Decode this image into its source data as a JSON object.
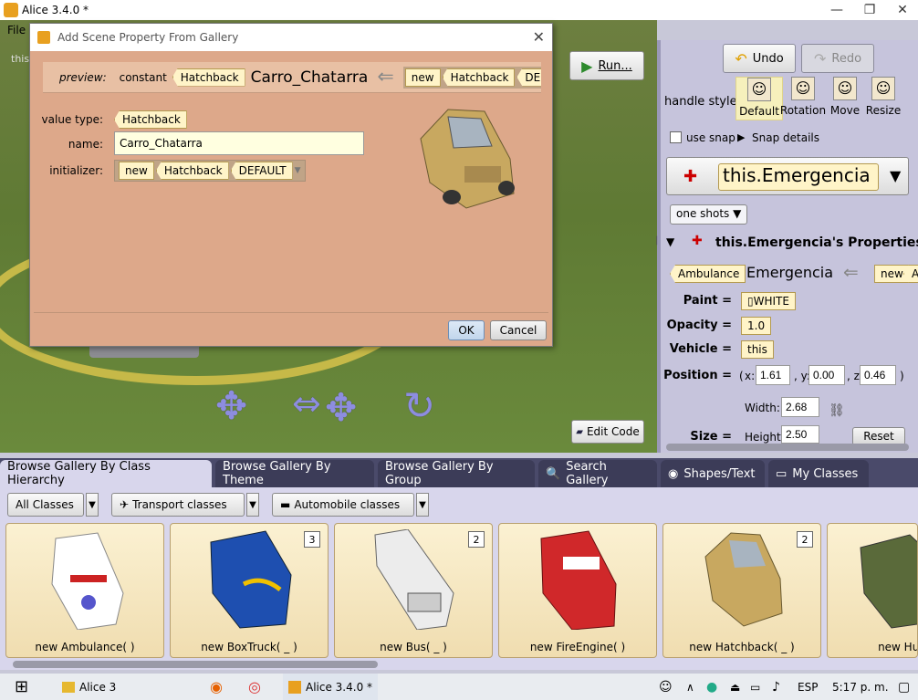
{
  "window": {
    "title": "Alice 3.4.0  *",
    "min": "—",
    "restore": "❐",
    "close": "✕"
  },
  "menu": {
    "file": "File",
    "scene_label": "this"
  },
  "run_button": "Run...",
  "edit_code_button": "Edit Code",
  "dialog": {
    "title": "Add Scene Property From Gallery",
    "close": "✕",
    "preview_label": "preview:",
    "preview_constant": "constant",
    "preview_type": "Hatchback",
    "preview_name": "Carro_Chatarra",
    "preview_new": "new",
    "preview_new_type": "Hatchback",
    "preview_default": "DEFA",
    "value_type_label": "value type:",
    "value_type": "Hatchback",
    "name_label": "name:",
    "name_value": "Carro_Chatarra",
    "initializer_label": "initializer:",
    "init_new": "new",
    "init_type": "Hatchback",
    "init_default": "DEFAULT",
    "ok": "OK",
    "cancel": "Cancel"
  },
  "right_panel": {
    "undo": "Undo",
    "redo": "Redo",
    "handle_style_label": "handle style:",
    "handles": [
      {
        "label": "Default",
        "icon": "default-handle-icon"
      },
      {
        "label": "Rotation",
        "icon": "rotation-handle-icon"
      },
      {
        "label": "Move",
        "icon": "move-handle-icon"
      },
      {
        "label": "Resize",
        "icon": "resize-handle-icon"
      }
    ],
    "use_snap": "use snap",
    "snap_details": "Snap details",
    "selected_object": "this.Emergencia",
    "one_shots": "one shots",
    "properties_title": "this.Emergencia's Properties",
    "type": "Ambulance",
    "obj_name": "Emergencia",
    "new": "new",
    "new_type": "Am",
    "paint_label": "Paint =",
    "paint_value": "WHITE",
    "opacity_label": "Opacity =",
    "opacity_value": "1.0",
    "vehicle_label": "Vehicle =",
    "vehicle_value": "this",
    "position_label": "Position =",
    "pos_open": "(",
    "pos_x_label": "x:",
    "pos_x": "1.61",
    "pos_y_label": ", y:",
    "pos_y": "0.00",
    "pos_z_label": ", z:",
    "pos_z": "0.46",
    "pos_close": ")",
    "width_label": "Width:",
    "width_value": "2.68",
    "size_label": "Size =",
    "height_label": "Height:",
    "height_value": "2.50",
    "reset": "Reset"
  },
  "gallery": {
    "tabs": [
      "Browse Gallery By Class Hierarchy",
      "Browse Gallery By Theme",
      "Browse Gallery By Group",
      "Search Gallery",
      "Shapes/Text",
      "My Classes"
    ],
    "filters": [
      "All Classes",
      "Transport classes",
      "Automobile classes"
    ],
    "cards": [
      {
        "label": "new Ambulance( )",
        "count": ""
      },
      {
        "label": "new BoxTruck( _ )",
        "count": "3"
      },
      {
        "label": "new Bus( _ )",
        "count": "2"
      },
      {
        "label": "new FireEngine( )",
        "count": ""
      },
      {
        "label": "new Hatchback( _ )",
        "count": "2"
      },
      {
        "label": "new Hum",
        "count": ""
      }
    ]
  },
  "taskbar": {
    "folder": "Alice 3",
    "alice_app": "Alice 3.4.0  *",
    "lang": "ESP",
    "time": "5:17 p. m."
  },
  "colors": {
    "dialog_bg": "#dda88a",
    "panel_bg": "#c6c4dc",
    "tile_bg": "#fff4c8",
    "grass": "#6a8a3c"
  }
}
